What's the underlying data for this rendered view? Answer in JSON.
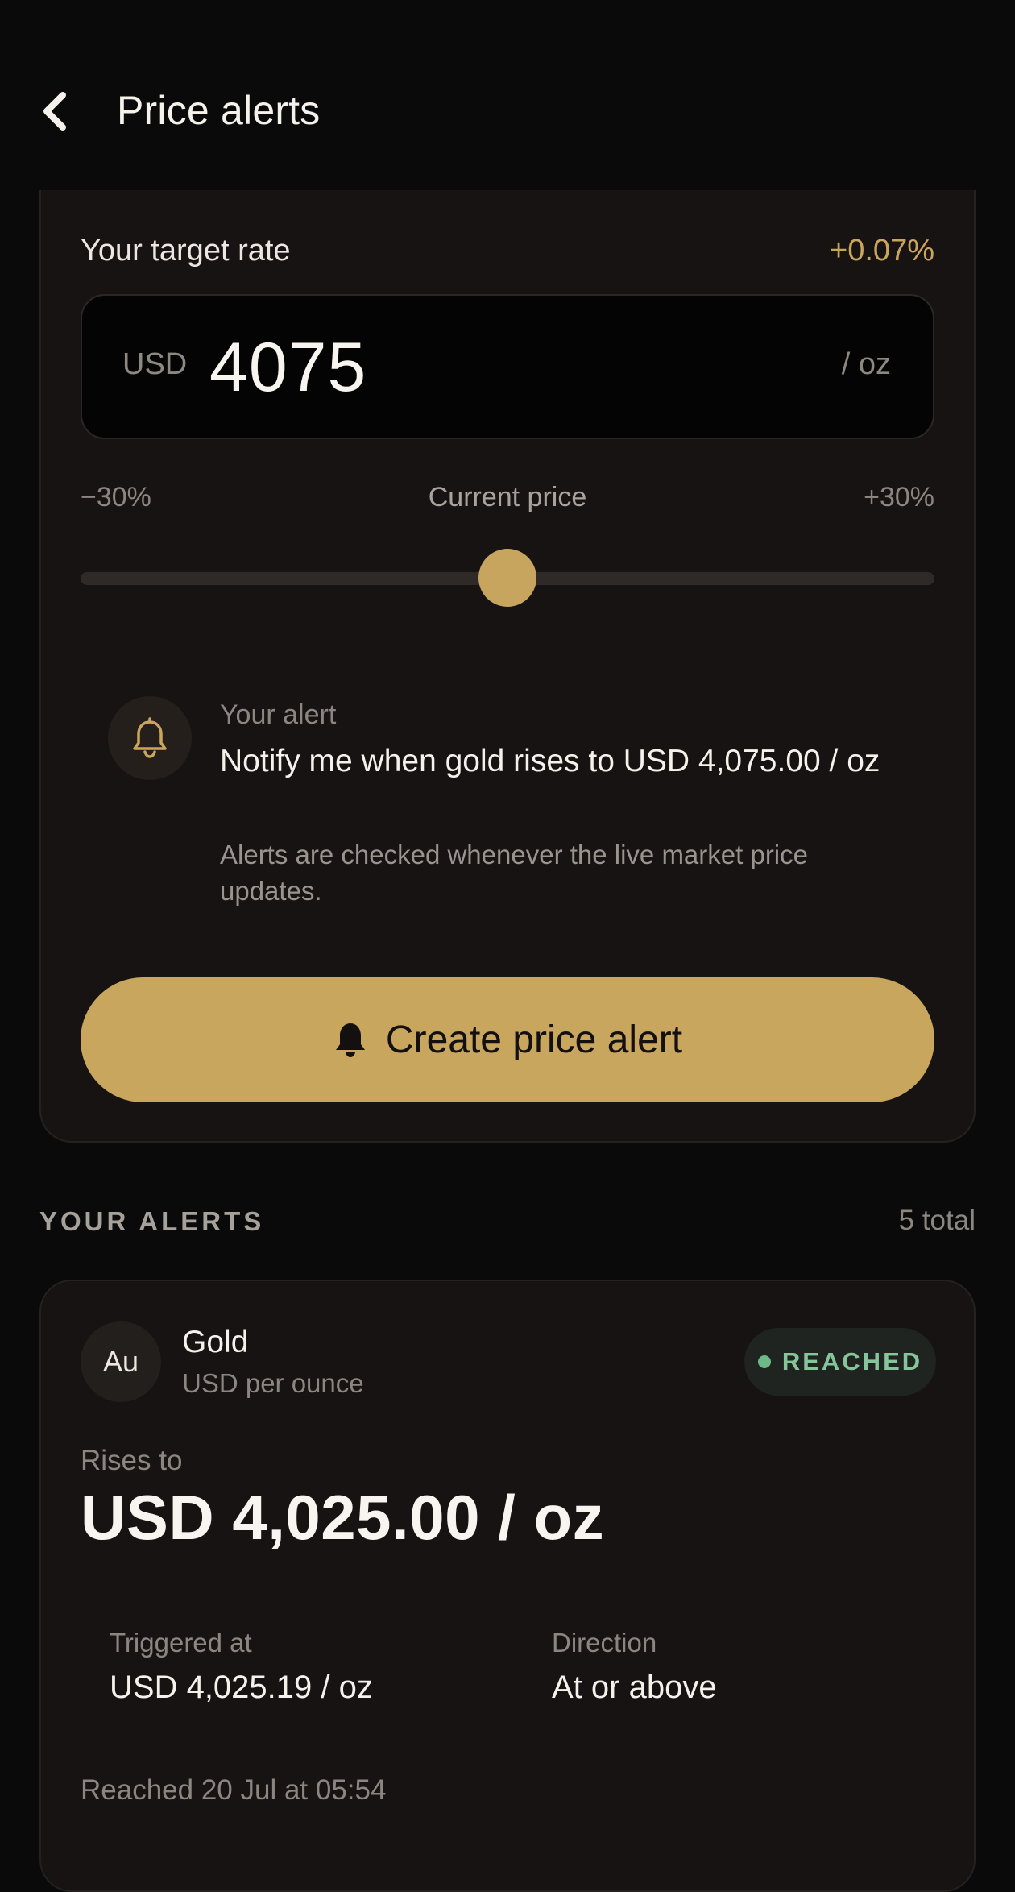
{
  "header": {
    "title": "Price alerts",
    "back_icon": "chevron-left-icon"
  },
  "create": {
    "target_label": "Your target rate",
    "target_delta": "+0.07%",
    "currency": "USD",
    "rate_value": "4075",
    "rate_unit": "/ oz",
    "slider": {
      "min_label": "−30%",
      "mid_label": "Current price",
      "max_label": "+30%",
      "value_fraction": 0.5
    },
    "alert_summary": {
      "icon": "bell-outline-icon",
      "label": "Your alert",
      "text": "Notify me when gold rises to USD 4,075.00 / oz",
      "note": "Alerts are checked whenever the live market price updates."
    },
    "button_label": "Create price alert",
    "button_icon": "bell-filled-icon"
  },
  "alerts_section": {
    "title": "YOUR ALERTS",
    "count": "5 total"
  },
  "alerts": [
    {
      "symbol": "Au",
      "name": "Gold",
      "unit": "USD per ounce",
      "status": "REACHED",
      "rule_label": "Rises to",
      "rule_value": "USD 4,025.00 / oz",
      "triggered_label": "Triggered at",
      "triggered_value": "USD 4,025.19 / oz",
      "direction_label": "Direction",
      "direction_value": "At or above",
      "reached_text": "Reached 20 Jul at 05:54"
    }
  ],
  "colors": {
    "background": "#0b0a0a",
    "card": "#171313",
    "accent_gold": "#c8a65e",
    "status_green": "#86c49a"
  }
}
